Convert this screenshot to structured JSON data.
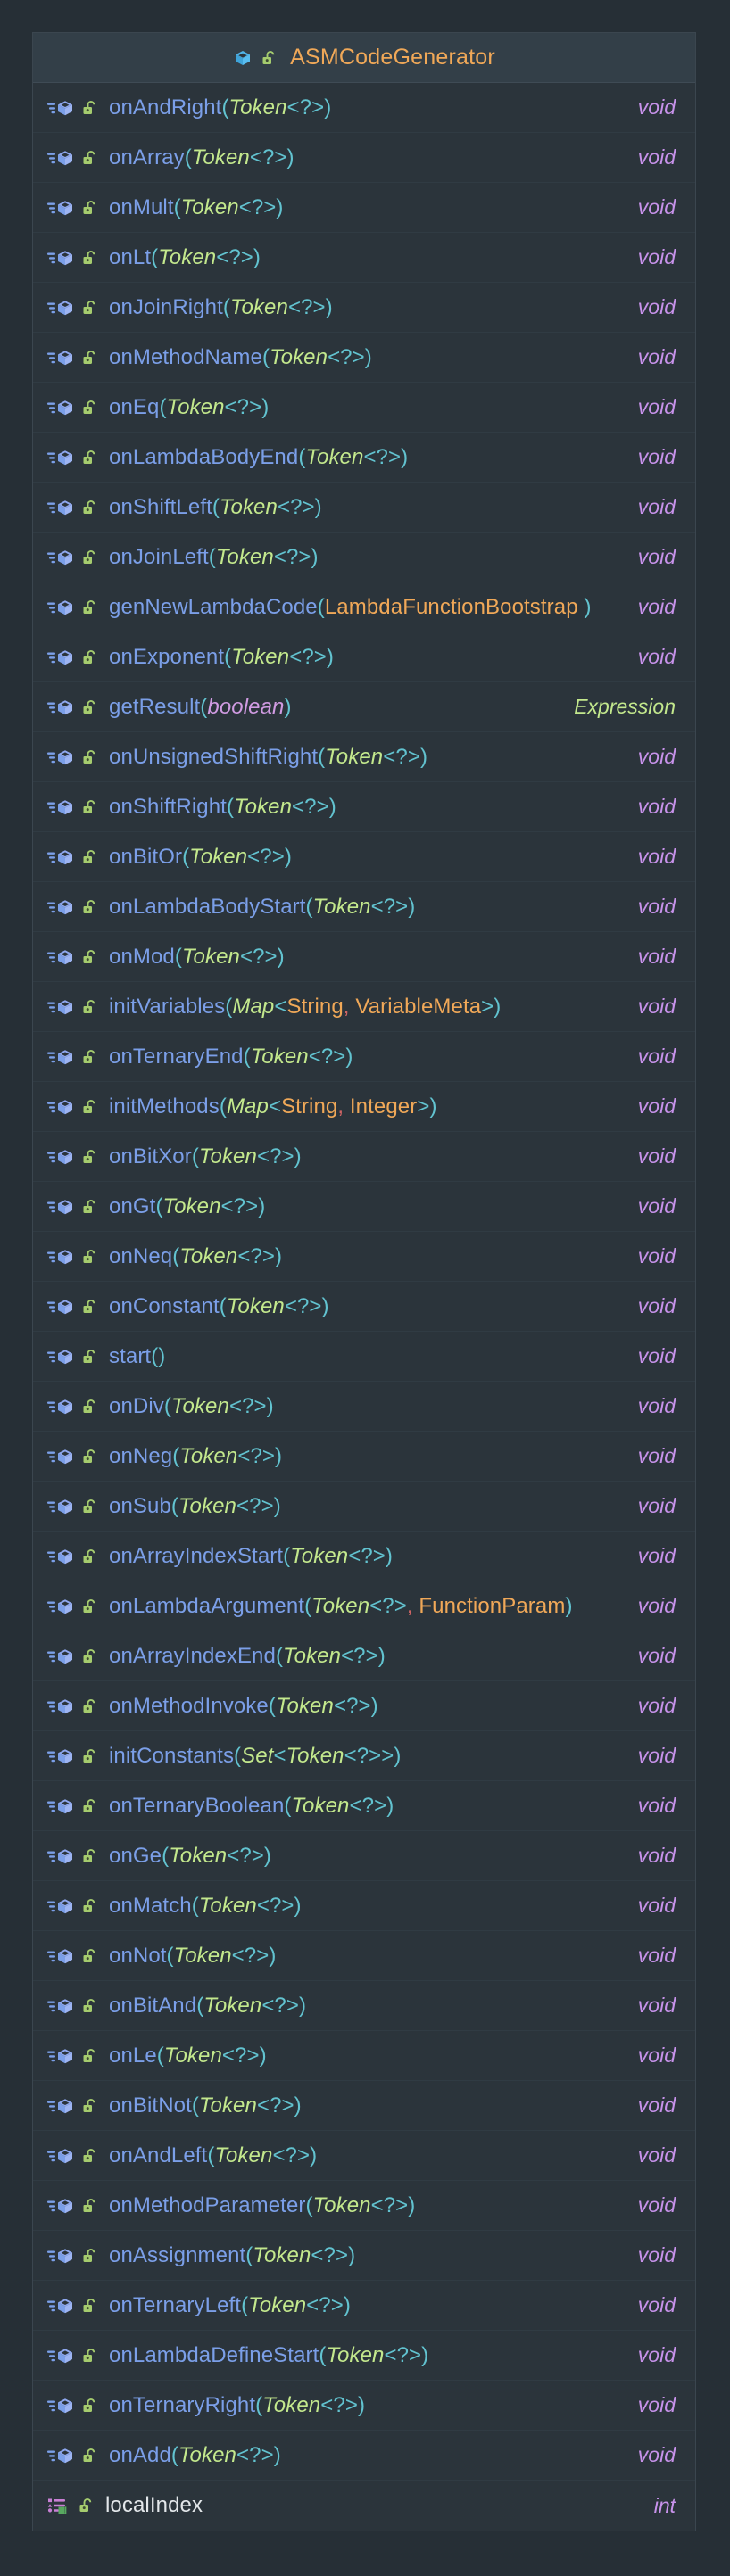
{
  "window": {
    "background_color": "#262f36",
    "panel_background_color": "#2b343b",
    "header_background_color": "#333f48",
    "border_color": "#3b464f"
  },
  "header": {
    "title": "ASMCodeGenerator",
    "title_color": "#f0a858",
    "icons": [
      "class-icon",
      "unlock-icon"
    ]
  },
  "colors": {
    "method_name": "#7b9fe8",
    "field_name": "#e3e7ea",
    "parenthesis": "#62c3d0",
    "class_type_italic": "#c3e88d",
    "class_type": "#f0a858",
    "primitive_type": "#d09be2",
    "return_void": "#c792ea"
  },
  "members": [
    {
      "kind": "method",
      "icons": [
        "method-icon",
        "unlock-icon"
      ],
      "name": "onAndRight",
      "params": [
        {
          "text": "Token",
          "style": "cls-it"
        },
        {
          "text": "<?>",
          "style": "angle"
        }
      ],
      "return": "void",
      "return_style": "void"
    },
    {
      "kind": "method",
      "icons": [
        "method-icon",
        "unlock-icon"
      ],
      "name": "onArray",
      "params": [
        {
          "text": "Token",
          "style": "cls-it"
        },
        {
          "text": "<?>",
          "style": "angle"
        }
      ],
      "return": "void",
      "return_style": "void"
    },
    {
      "kind": "method",
      "icons": [
        "method-icon",
        "unlock-icon"
      ],
      "name": "onMult",
      "params": [
        {
          "text": "Token",
          "style": "cls-it"
        },
        {
          "text": "<?>",
          "style": "angle"
        }
      ],
      "return": "void",
      "return_style": "void"
    },
    {
      "kind": "method",
      "icons": [
        "method-icon",
        "unlock-icon"
      ],
      "name": "onLt",
      "params": [
        {
          "text": "Token",
          "style": "cls-it"
        },
        {
          "text": "<?>",
          "style": "angle"
        }
      ],
      "return": "void",
      "return_style": "void"
    },
    {
      "kind": "method",
      "icons": [
        "method-icon",
        "unlock-icon"
      ],
      "name": "onJoinRight",
      "params": [
        {
          "text": "Token",
          "style": "cls-it"
        },
        {
          "text": "<?>",
          "style": "angle"
        }
      ],
      "return": "void",
      "return_style": "void"
    },
    {
      "kind": "method",
      "icons": [
        "method-icon",
        "unlock-icon"
      ],
      "name": "onMethodName",
      "params": [
        {
          "text": "Token",
          "style": "cls-it"
        },
        {
          "text": "<?>",
          "style": "angle"
        }
      ],
      "return": "void",
      "return_style": "void"
    },
    {
      "kind": "method",
      "icons": [
        "method-icon",
        "unlock-icon"
      ],
      "name": "onEq",
      "params": [
        {
          "text": "Token",
          "style": "cls-it"
        },
        {
          "text": "<?>",
          "style": "angle"
        }
      ],
      "return": "void",
      "return_style": "void"
    },
    {
      "kind": "method",
      "icons": [
        "method-icon",
        "unlock-icon"
      ],
      "name": "onLambdaBodyEnd",
      "params": [
        {
          "text": "Token",
          "style": "cls-it"
        },
        {
          "text": "<?>",
          "style": "angle"
        }
      ],
      "return": "void",
      "return_style": "void"
    },
    {
      "kind": "method",
      "icons": [
        "method-icon",
        "unlock-icon"
      ],
      "name": "onShiftLeft",
      "params": [
        {
          "text": "Token",
          "style": "cls-it"
        },
        {
          "text": "<?>",
          "style": "angle"
        }
      ],
      "return": "void",
      "return_style": "void"
    },
    {
      "kind": "method",
      "icons": [
        "method-icon",
        "unlock-icon"
      ],
      "name": "onJoinLeft",
      "params": [
        {
          "text": "Token",
          "style": "cls-it"
        },
        {
          "text": "<?>",
          "style": "angle"
        }
      ],
      "return": "void",
      "return_style": "void"
    },
    {
      "kind": "method",
      "icons": [
        "method-icon",
        "unlock-icon"
      ],
      "name": "genNewLambdaCode",
      "params": [
        {
          "text": "LambdaFunctionBootstrap",
          "style": "cls"
        },
        {
          "text": " ",
          "style": "plain"
        }
      ],
      "return": "void",
      "return_style": "void"
    },
    {
      "kind": "method",
      "icons": [
        "method-icon",
        "unlock-icon"
      ],
      "name": "onExponent",
      "params": [
        {
          "text": "Token",
          "style": "cls-it"
        },
        {
          "text": "<?>",
          "style": "angle"
        }
      ],
      "return": "void",
      "return_style": "void"
    },
    {
      "kind": "method",
      "icons": [
        "method-icon",
        "unlock-icon"
      ],
      "name": "getResult",
      "params": [
        {
          "text": "boolean",
          "style": "prim"
        }
      ],
      "return": "Expression",
      "return_style": "cls"
    },
    {
      "kind": "method",
      "icons": [
        "method-icon",
        "unlock-icon"
      ],
      "name": "onUnsignedShiftRight",
      "params": [
        {
          "text": "Token",
          "style": "cls-it"
        },
        {
          "text": "<?>",
          "style": "angle"
        }
      ],
      "return": "void",
      "return_style": "void"
    },
    {
      "kind": "method",
      "icons": [
        "method-icon",
        "unlock-icon"
      ],
      "name": "onShiftRight",
      "params": [
        {
          "text": "Token",
          "style": "cls-it"
        },
        {
          "text": "<?>",
          "style": "angle"
        }
      ],
      "return": "void",
      "return_style": "void"
    },
    {
      "kind": "method",
      "icons": [
        "method-icon",
        "unlock-icon"
      ],
      "name": "onBitOr",
      "params": [
        {
          "text": "Token",
          "style": "cls-it"
        },
        {
          "text": "<?>",
          "style": "angle"
        }
      ],
      "return": "void",
      "return_style": "void"
    },
    {
      "kind": "method",
      "icons": [
        "method-icon",
        "unlock-icon"
      ],
      "name": "onLambdaBodyStart",
      "params": [
        {
          "text": "Token",
          "style": "cls-it"
        },
        {
          "text": "<?>",
          "style": "angle"
        }
      ],
      "return": "void",
      "return_style": "void"
    },
    {
      "kind": "method",
      "icons": [
        "method-icon",
        "unlock-icon"
      ],
      "name": "onMod",
      "params": [
        {
          "text": "Token",
          "style": "cls-it"
        },
        {
          "text": "<?>",
          "style": "angle"
        }
      ],
      "return": "void",
      "return_style": "void"
    },
    {
      "kind": "method",
      "icons": [
        "method-icon",
        "unlock-icon"
      ],
      "name": "initVariables",
      "params": [
        {
          "text": "Map",
          "style": "cls-it"
        },
        {
          "text": "<",
          "style": "angle"
        },
        {
          "text": "String",
          "style": "cls"
        },
        {
          "text": ", ",
          "style": "comma"
        },
        {
          "text": "VariableMeta",
          "style": "cls"
        },
        {
          "text": ">",
          "style": "angle"
        }
      ],
      "return": "void",
      "return_style": "void"
    },
    {
      "kind": "method",
      "icons": [
        "method-icon",
        "unlock-icon"
      ],
      "name": "onTernaryEnd",
      "params": [
        {
          "text": "Token",
          "style": "cls-it"
        },
        {
          "text": "<?>",
          "style": "angle"
        }
      ],
      "return": "void",
      "return_style": "void"
    },
    {
      "kind": "method",
      "icons": [
        "method-icon",
        "unlock-icon"
      ],
      "name": "initMethods",
      "params": [
        {
          "text": "Map",
          "style": "cls-it"
        },
        {
          "text": "<",
          "style": "angle"
        },
        {
          "text": "String",
          "style": "cls"
        },
        {
          "text": ", ",
          "style": "comma"
        },
        {
          "text": "Integer",
          "style": "cls"
        },
        {
          "text": ">",
          "style": "angle"
        }
      ],
      "return": "void",
      "return_style": "void"
    },
    {
      "kind": "method",
      "icons": [
        "method-icon",
        "unlock-icon"
      ],
      "name": "onBitXor",
      "params": [
        {
          "text": "Token",
          "style": "cls-it"
        },
        {
          "text": "<?>",
          "style": "angle"
        }
      ],
      "return": "void",
      "return_style": "void"
    },
    {
      "kind": "method",
      "icons": [
        "method-icon",
        "unlock-icon"
      ],
      "name": "onGt",
      "params": [
        {
          "text": "Token",
          "style": "cls-it"
        },
        {
          "text": "<?>",
          "style": "angle"
        }
      ],
      "return": "void",
      "return_style": "void"
    },
    {
      "kind": "method",
      "icons": [
        "method-icon",
        "unlock-icon"
      ],
      "name": "onNeq",
      "params": [
        {
          "text": "Token",
          "style": "cls-it"
        },
        {
          "text": "<?>",
          "style": "angle"
        }
      ],
      "return": "void",
      "return_style": "void"
    },
    {
      "kind": "method",
      "icons": [
        "method-icon",
        "unlock-icon"
      ],
      "name": "onConstant",
      "params": [
        {
          "text": "Token",
          "style": "cls-it"
        },
        {
          "text": "<?>",
          "style": "angle"
        }
      ],
      "return": "void",
      "return_style": "void"
    },
    {
      "kind": "method",
      "icons": [
        "method-icon",
        "unlock-icon"
      ],
      "name": "start",
      "params": [],
      "return": "void",
      "return_style": "void"
    },
    {
      "kind": "method",
      "icons": [
        "method-icon",
        "unlock-icon"
      ],
      "name": "onDiv",
      "params": [
        {
          "text": "Token",
          "style": "cls-it"
        },
        {
          "text": "<?>",
          "style": "angle"
        }
      ],
      "return": "void",
      "return_style": "void"
    },
    {
      "kind": "method",
      "icons": [
        "method-icon",
        "unlock-icon"
      ],
      "name": "onNeg",
      "params": [
        {
          "text": "Token",
          "style": "cls-it"
        },
        {
          "text": "<?>",
          "style": "angle"
        }
      ],
      "return": "void",
      "return_style": "void"
    },
    {
      "kind": "method",
      "icons": [
        "method-icon",
        "unlock-icon"
      ],
      "name": "onSub",
      "params": [
        {
          "text": "Token",
          "style": "cls-it"
        },
        {
          "text": "<?>",
          "style": "angle"
        }
      ],
      "return": "void",
      "return_style": "void"
    },
    {
      "kind": "method",
      "icons": [
        "method-icon",
        "unlock-icon"
      ],
      "name": "onArrayIndexStart",
      "params": [
        {
          "text": "Token",
          "style": "cls-it"
        },
        {
          "text": "<?>",
          "style": "angle"
        }
      ],
      "return": "void",
      "return_style": "void"
    },
    {
      "kind": "method",
      "icons": [
        "method-icon",
        "unlock-icon"
      ],
      "name": "onLambdaArgument",
      "params": [
        {
          "text": "Token",
          "style": "cls-it"
        },
        {
          "text": "<?>",
          "style": "angle"
        },
        {
          "text": ", ",
          "style": "comma"
        },
        {
          "text": "FunctionParam",
          "style": "cls"
        }
      ],
      "return": "void",
      "return_style": "void"
    },
    {
      "kind": "method",
      "icons": [
        "method-icon",
        "unlock-icon"
      ],
      "name": "onArrayIndexEnd",
      "params": [
        {
          "text": "Token",
          "style": "cls-it"
        },
        {
          "text": "<?>",
          "style": "angle"
        }
      ],
      "return": "void",
      "return_style": "void"
    },
    {
      "kind": "method",
      "icons": [
        "method-icon",
        "unlock-icon"
      ],
      "name": "onMethodInvoke",
      "params": [
        {
          "text": "Token",
          "style": "cls-it"
        },
        {
          "text": "<?>",
          "style": "angle"
        }
      ],
      "return": "void",
      "return_style": "void"
    },
    {
      "kind": "method",
      "icons": [
        "method-icon",
        "unlock-icon"
      ],
      "name": "initConstants",
      "params": [
        {
          "text": "Set",
          "style": "cls-it"
        },
        {
          "text": "<",
          "style": "angle"
        },
        {
          "text": "Token",
          "style": "cls-it"
        },
        {
          "text": "<?>>",
          "style": "angle"
        }
      ],
      "return": "void",
      "return_style": "void"
    },
    {
      "kind": "method",
      "icons": [
        "method-icon",
        "unlock-icon"
      ],
      "name": "onTernaryBoolean",
      "params": [
        {
          "text": "Token",
          "style": "cls-it"
        },
        {
          "text": "<?>",
          "style": "angle"
        }
      ],
      "return": "void",
      "return_style": "void"
    },
    {
      "kind": "method",
      "icons": [
        "method-icon",
        "unlock-icon"
      ],
      "name": "onGe",
      "params": [
        {
          "text": "Token",
          "style": "cls-it"
        },
        {
          "text": "<?>",
          "style": "angle"
        }
      ],
      "return": "void",
      "return_style": "void"
    },
    {
      "kind": "method",
      "icons": [
        "method-icon",
        "unlock-icon"
      ],
      "name": "onMatch",
      "params": [
        {
          "text": "Token",
          "style": "cls-it"
        },
        {
          "text": "<?>",
          "style": "angle"
        }
      ],
      "return": "void",
      "return_style": "void"
    },
    {
      "kind": "method",
      "icons": [
        "method-icon",
        "unlock-icon"
      ],
      "name": "onNot",
      "params": [
        {
          "text": "Token",
          "style": "cls-it"
        },
        {
          "text": "<?>",
          "style": "angle"
        }
      ],
      "return": "void",
      "return_style": "void"
    },
    {
      "kind": "method",
      "icons": [
        "method-icon",
        "unlock-icon"
      ],
      "name": "onBitAnd",
      "params": [
        {
          "text": "Token",
          "style": "cls-it"
        },
        {
          "text": "<?>",
          "style": "angle"
        }
      ],
      "return": "void",
      "return_style": "void"
    },
    {
      "kind": "method",
      "icons": [
        "method-icon",
        "unlock-icon"
      ],
      "name": "onLe",
      "params": [
        {
          "text": "Token",
          "style": "cls-it"
        },
        {
          "text": "<?>",
          "style": "angle"
        }
      ],
      "return": "void",
      "return_style": "void"
    },
    {
      "kind": "method",
      "icons": [
        "method-icon",
        "unlock-icon"
      ],
      "name": "onBitNot",
      "params": [
        {
          "text": "Token",
          "style": "cls-it"
        },
        {
          "text": "<?>",
          "style": "angle"
        }
      ],
      "return": "void",
      "return_style": "void"
    },
    {
      "kind": "method",
      "icons": [
        "method-icon",
        "unlock-icon"
      ],
      "name": "onAndLeft",
      "params": [
        {
          "text": "Token",
          "style": "cls-it"
        },
        {
          "text": "<?>",
          "style": "angle"
        }
      ],
      "return": "void",
      "return_style": "void"
    },
    {
      "kind": "method",
      "icons": [
        "method-icon",
        "unlock-icon"
      ],
      "name": "onMethodParameter",
      "params": [
        {
          "text": "Token",
          "style": "cls-it"
        },
        {
          "text": "<?>",
          "style": "angle"
        }
      ],
      "return": "void",
      "return_style": "void"
    },
    {
      "kind": "method",
      "icons": [
        "method-icon",
        "unlock-icon"
      ],
      "name": "onAssignment",
      "params": [
        {
          "text": "Token",
          "style": "cls-it"
        },
        {
          "text": "<?>",
          "style": "angle"
        }
      ],
      "return": "void",
      "return_style": "void"
    },
    {
      "kind": "method",
      "icons": [
        "method-icon",
        "unlock-icon"
      ],
      "name": "onTernaryLeft",
      "params": [
        {
          "text": "Token",
          "style": "cls-it"
        },
        {
          "text": "<?>",
          "style": "angle"
        }
      ],
      "return": "void",
      "return_style": "void"
    },
    {
      "kind": "method",
      "icons": [
        "method-icon",
        "unlock-icon"
      ],
      "name": "onLambdaDefineStart",
      "params": [
        {
          "text": "Token",
          "style": "cls-it"
        },
        {
          "text": "<?>",
          "style": "angle"
        }
      ],
      "return": "void",
      "return_style": "void"
    },
    {
      "kind": "method",
      "icons": [
        "method-icon",
        "unlock-icon"
      ],
      "name": "onTernaryRight",
      "params": [
        {
          "text": "Token",
          "style": "cls-it"
        },
        {
          "text": "<?>",
          "style": "angle"
        }
      ],
      "return": "void",
      "return_style": "void"
    },
    {
      "kind": "method",
      "icons": [
        "method-icon",
        "unlock-icon"
      ],
      "name": "onAdd",
      "params": [
        {
          "text": "Token",
          "style": "cls-it"
        },
        {
          "text": "<?>",
          "style": "angle"
        }
      ],
      "return": "void",
      "return_style": "void"
    },
    {
      "kind": "field",
      "icons": [
        "field-icon",
        "unlock-icon"
      ],
      "name": "localIndex",
      "params": null,
      "return": "int",
      "return_style": "primitive"
    }
  ]
}
